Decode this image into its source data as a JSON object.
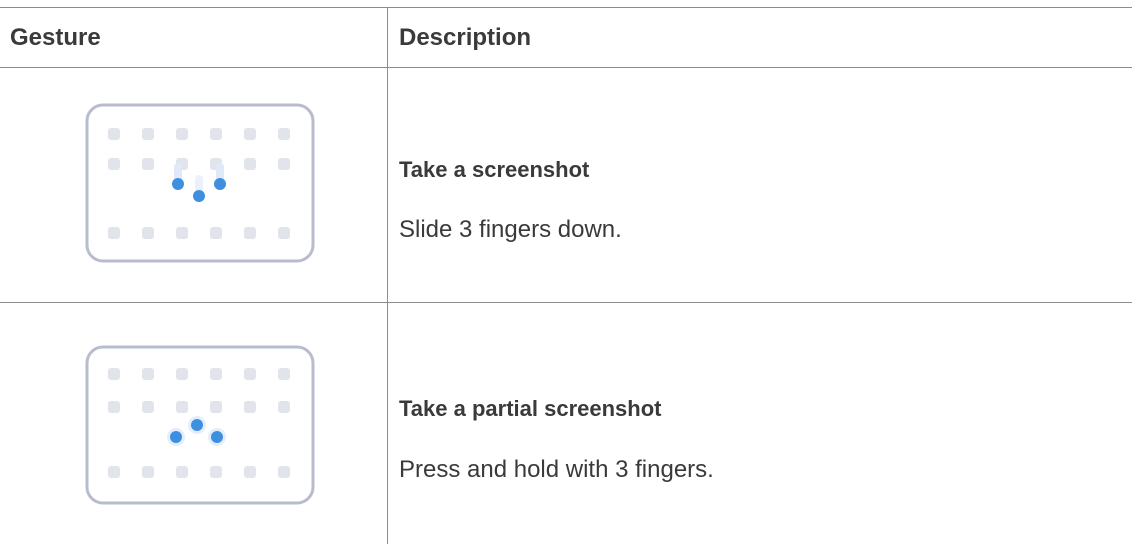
{
  "table": {
    "headers": {
      "gesture": "Gesture",
      "description": "Description"
    },
    "rows": [
      {
        "gesture_icon": "three-finger-swipe-down-icon",
        "title": "Take a screenshot",
        "text": "Slide 3 fingers down."
      },
      {
        "gesture_icon": "three-finger-press-hold-icon",
        "title": "Take a partial screenshot",
        "text": "Press and hold with 3 fingers."
      }
    ]
  },
  "colors": {
    "border": "#8c8c8c",
    "text": "#3a3a3a",
    "frame": "#b8bccd",
    "dot": "#e2e4ec",
    "touch": "#3f8fe0"
  }
}
